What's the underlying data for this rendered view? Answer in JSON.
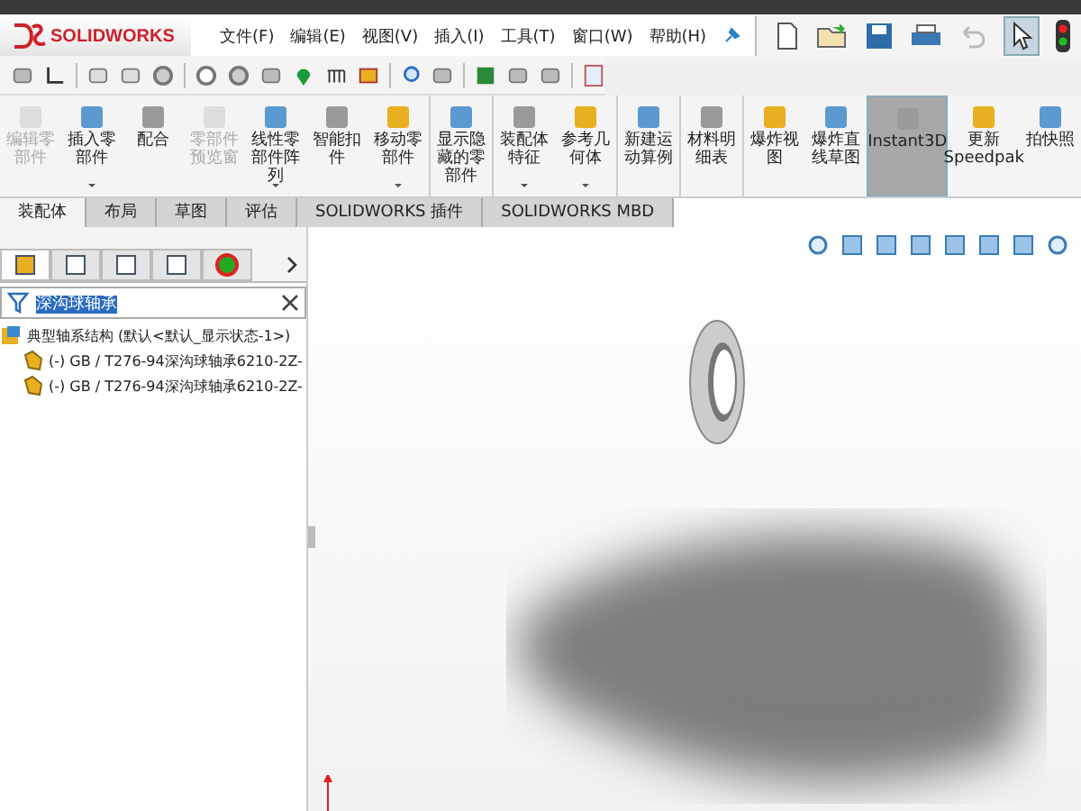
{
  "app": {
    "logo": "SOLIDWORKS"
  },
  "menu": [
    {
      "label": "文件(F)"
    },
    {
      "label": "编辑(E)"
    },
    {
      "label": "视图(V)"
    },
    {
      "label": "插入(I)"
    },
    {
      "label": "工具(T)"
    },
    {
      "label": "窗口(W)"
    },
    {
      "label": "帮助(H)"
    }
  ],
  "ribbon": [
    {
      "label": "编辑零部件",
      "disabled": true,
      "selected": false,
      "dropdown": false,
      "group_end": false
    },
    {
      "label": "插入零部件",
      "disabled": false,
      "selected": false,
      "dropdown": true,
      "group_end": false
    },
    {
      "label": "配合",
      "disabled": false,
      "selected": false,
      "dropdown": false,
      "group_end": false
    },
    {
      "label": "零部件预览窗",
      "disabled": true,
      "selected": false,
      "dropdown": false,
      "group_end": false
    },
    {
      "label": "线性零部件阵列",
      "disabled": false,
      "selected": false,
      "dropdown": true,
      "group_end": false
    },
    {
      "label": "智能扣件",
      "disabled": false,
      "selected": false,
      "dropdown": false,
      "group_end": false
    },
    {
      "label": "移动零部件",
      "disabled": false,
      "selected": false,
      "dropdown": true,
      "group_end": true
    },
    {
      "label": "显示隐藏的零部件",
      "disabled": false,
      "selected": false,
      "dropdown": false,
      "group_end": true
    },
    {
      "label": "装配体特征",
      "disabled": false,
      "selected": false,
      "dropdown": true,
      "group_end": false
    },
    {
      "label": "参考几何体",
      "disabled": false,
      "selected": false,
      "dropdown": true,
      "group_end": true
    },
    {
      "label": "新建运动算例",
      "disabled": false,
      "selected": false,
      "dropdown": false,
      "group_end": true
    },
    {
      "label": "材料明细表",
      "disabled": false,
      "selected": false,
      "dropdown": false,
      "group_end": true
    },
    {
      "label": "爆炸视图",
      "disabled": false,
      "selected": false,
      "dropdown": false,
      "group_end": false
    },
    {
      "label": "爆炸直线草图",
      "disabled": false,
      "selected": false,
      "dropdown": false,
      "group_end": false
    },
    {
      "label": "Instant3D",
      "disabled": false,
      "selected": true,
      "dropdown": false,
      "group_end": false
    },
    {
      "label": "更新Speedpak",
      "disabled": false,
      "selected": false,
      "dropdown": false,
      "group_end": false
    },
    {
      "label": "拍快照",
      "disabled": false,
      "selected": false,
      "dropdown": false,
      "group_end": false
    }
  ],
  "tabs": [
    {
      "label": "装配体",
      "selected": true
    },
    {
      "label": "布局",
      "selected": false
    },
    {
      "label": "草图",
      "selected": false
    },
    {
      "label": "评估",
      "selected": false
    },
    {
      "label": "SOLIDWORKS 插件",
      "selected": false
    },
    {
      "label": "SOLIDWORKS MBD",
      "selected": false
    }
  ],
  "panel_tabs": [
    {
      "selected": true
    },
    {
      "selected": false
    },
    {
      "selected": false
    },
    {
      "selected": false
    },
    {
      "selected": false
    }
  ],
  "filter": {
    "value": "深沟球轴承"
  },
  "tree": [
    {
      "label": "典型轴系结构  (默认<默认_显示状态-1>)",
      "children": [
        {
          "label": "(-) GB / T276-94深沟球轴承6210-2Z-"
        },
        {
          "label": "(-) GB / T276-94深沟球轴承6210-2Z-"
        }
      ]
    }
  ]
}
